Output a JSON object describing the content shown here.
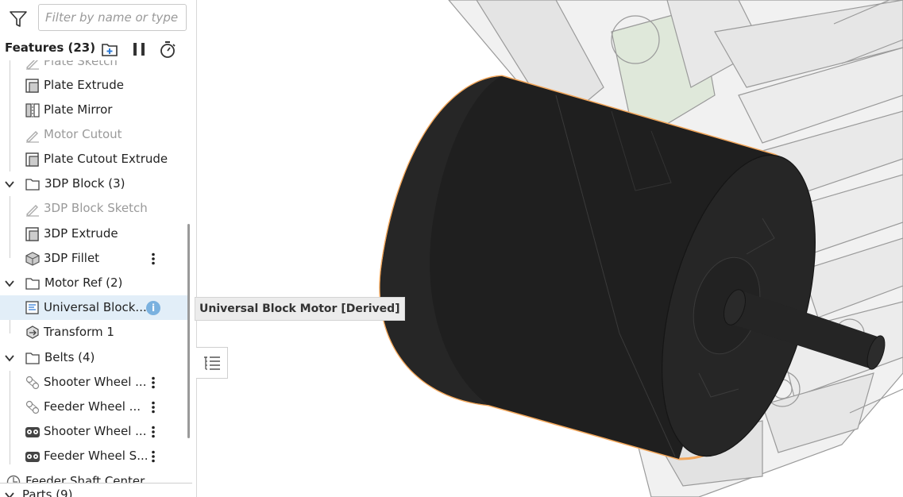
{
  "filter": {
    "placeholder": "Filter by name or type",
    "value": ""
  },
  "features": {
    "title": "Features (23)"
  },
  "tree": {
    "partial_top": "Plate Sketch",
    "items": [
      {
        "label": "Plate Extrude",
        "icon": "extrude-icon"
      },
      {
        "label": "Plate Mirror",
        "icon": "mirror-icon"
      },
      {
        "label": "Motor Cutout",
        "icon": "sketch-icon",
        "dim": true
      },
      {
        "label": "Plate Cutout Extrude",
        "icon": "extrude-icon"
      },
      {
        "label": "3DP Block (3)",
        "icon": "folder-icon",
        "folder": true
      },
      {
        "label": "3DP Block Sketch",
        "icon": "sketch-icon",
        "dim": true
      },
      {
        "label": "3DP Extrude",
        "icon": "extrude-icon"
      },
      {
        "label": "3DP Fillet",
        "icon": "fillet-icon"
      },
      {
        "label": "Motor Ref (2)",
        "icon": "folder-icon",
        "folder": true
      },
      {
        "label": "Universal Block...",
        "icon": "derived-icon",
        "selected": true
      },
      {
        "label": "Transform 1",
        "icon": "transform-icon"
      },
      {
        "label": "Belts (4)",
        "icon": "folder-icon",
        "folder": true
      },
      {
        "label": "Shooter Wheel ...",
        "icon": "belt-sketch-icon"
      },
      {
        "label": "Feeder Wheel ...",
        "icon": "belt-sketch-icon"
      },
      {
        "label": "Shooter Wheel ...",
        "icon": "belt-feature-icon"
      },
      {
        "label": "Feeder Wheel S...",
        "icon": "belt-feature-icon"
      }
    ],
    "partial_bottom": "Feeder Shaft Center",
    "parts": "Parts (9)"
  },
  "tooltip": {
    "text": "Universal Block Motor [Derived]"
  },
  "colors": {
    "selection": "#e2eef8",
    "highlight_outline": "#f2a65a",
    "info_badge": "#7ab1df"
  }
}
